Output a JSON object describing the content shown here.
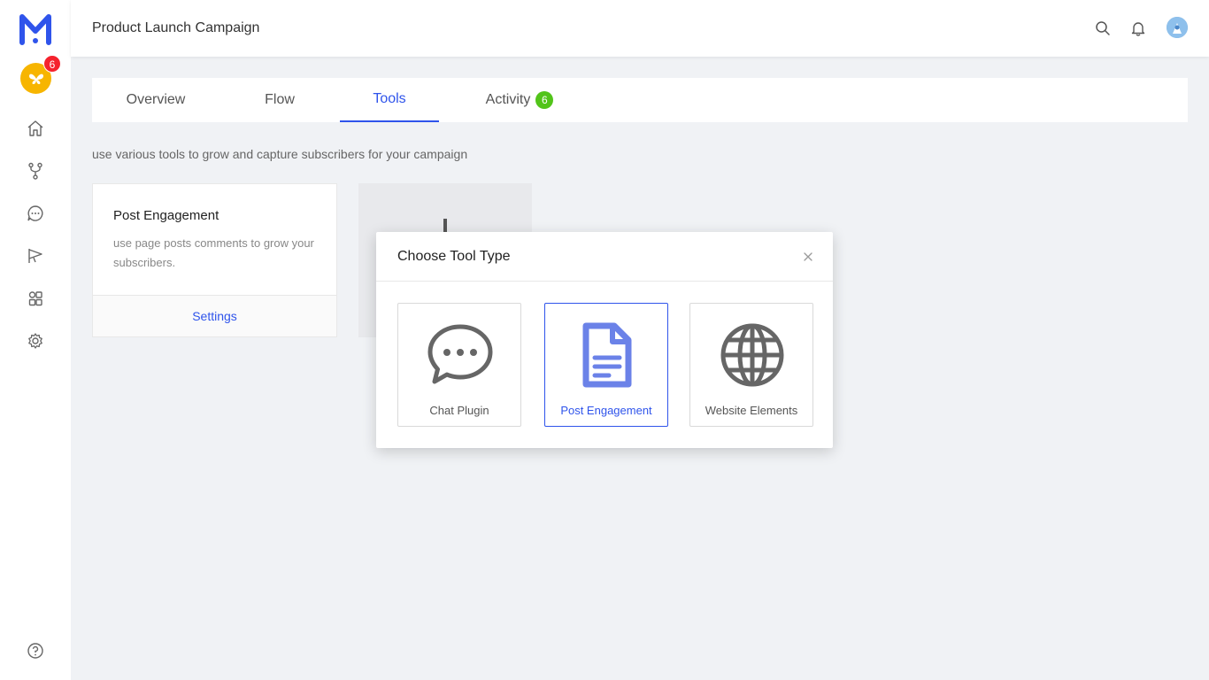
{
  "app": {
    "page_title": "Product Launch Campaign",
    "workspace_badge": "6"
  },
  "sidebar": {
    "items": [
      {
        "icon": "home-icon"
      },
      {
        "icon": "flow-icon"
      },
      {
        "icon": "chat-icon"
      },
      {
        "icon": "broadcast-icon"
      },
      {
        "icon": "integrations-icon"
      },
      {
        "icon": "settings-icon"
      },
      {
        "icon": "help-icon"
      }
    ]
  },
  "tabs": [
    {
      "label": "Overview"
    },
    {
      "label": "Flow"
    },
    {
      "label": "Tools",
      "active": true
    },
    {
      "label": "Activity",
      "badge": "6"
    }
  ],
  "main": {
    "subtitle": "use various tools to grow and capture subscribers for your campaign",
    "card": {
      "title": "Post Engagement",
      "description": "use page posts comments to grow your subscribers.",
      "footer": "Settings"
    }
  },
  "modal": {
    "title": "Choose Tool Type",
    "options": [
      {
        "label": "Chat Plugin",
        "icon": "chat-bubble-icon"
      },
      {
        "label": "Post Engagement",
        "icon": "document-icon",
        "selected": true
      },
      {
        "label": "Website Elements",
        "icon": "globe-icon"
      }
    ]
  },
  "colors": {
    "primary": "#2f54eb",
    "badge_red": "#f5222d",
    "badge_green": "#52c41a",
    "workspace": "#f7b500",
    "selected_icon": "#6b82e8",
    "icon_gray": "#666666"
  }
}
